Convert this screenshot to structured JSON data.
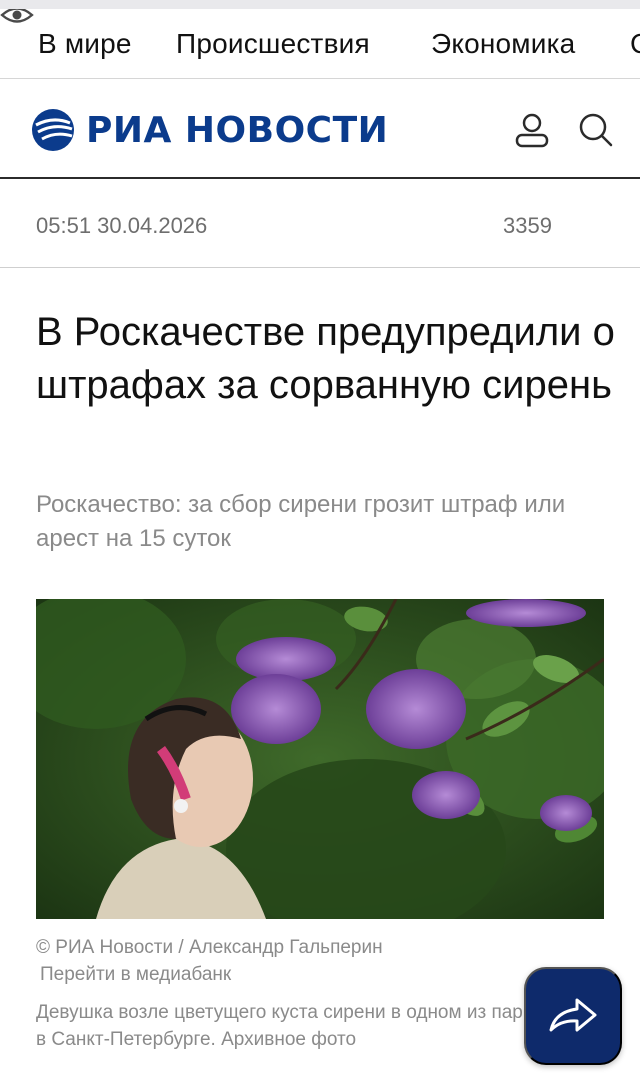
{
  "nav": {
    "items": [
      {
        "label": "В мире"
      },
      {
        "label": "Происшествия"
      },
      {
        "label": "Экономика"
      },
      {
        "label": "С"
      }
    ]
  },
  "header": {
    "logo_text": "РИА НОВОСТИ",
    "icons": [
      "user-icon",
      "search-icon"
    ]
  },
  "meta": {
    "datetime": "05:51 30.04.2026",
    "views": "3359"
  },
  "article": {
    "title": "В Роскачестве предупредили о штрафах за сорванную сирень",
    "subtitle": "Роскачество: за сбор сирени грозит штраф или арест на 15 суток",
    "photo_credit": "© РИА Новости / Александр Гальперин",
    "mediabank_link": "Перейти в медиабанк",
    "caption": "Девушка возле цветущего куста сирени в одном из парков в Санкт-Петербурге. Архивное фото"
  },
  "share": {
    "icon": "share-arrow-icon"
  },
  "colors": {
    "brand": "#0b3b8c",
    "share_bg": "#0e2a6b",
    "muted_text": "#8a8a8a"
  }
}
